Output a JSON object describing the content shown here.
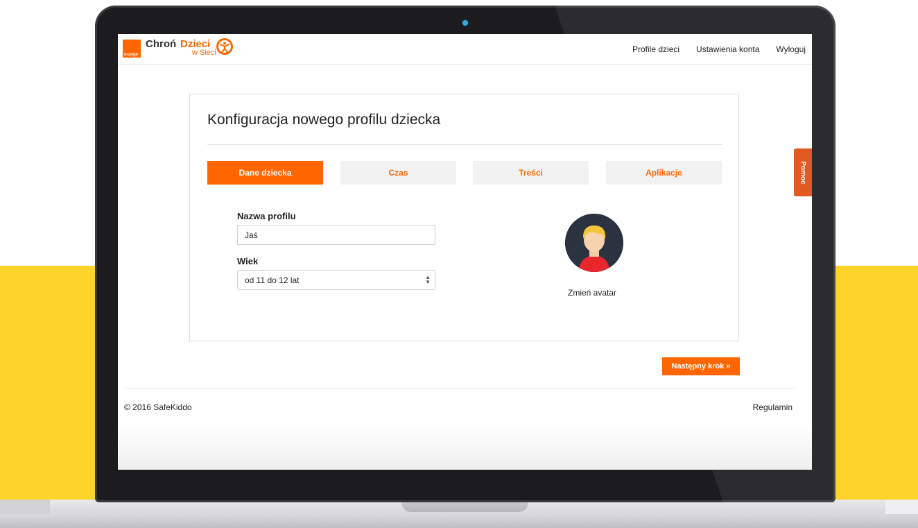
{
  "brand": {
    "orange_text": "orange",
    "chron": "Chroń",
    "dzieci": "Dzieci",
    "w_sieci": "w Sieci"
  },
  "nav": {
    "items": [
      "Profile dzieci",
      "Ustawienia konta",
      "Wyloguj"
    ]
  },
  "card": {
    "title": "Konfiguracja nowego profilu dziecka",
    "tabs": [
      "Dane dziecka",
      "Czas",
      "Treści",
      "Aplikacje"
    ],
    "active_tab": "Dane dziecka"
  },
  "form": {
    "name_label": "Nazwa profilu",
    "name_value": "Jaś",
    "age_label": "Wiek",
    "age_value": "od 11 do 12 lat"
  },
  "avatar": {
    "caption": "Zmień avatar"
  },
  "actions": {
    "next": "Następny krok »"
  },
  "footer": {
    "copyright": "© 2016 SafeKiddo",
    "terms": "Regulamin"
  },
  "help": {
    "label": "Pomoc"
  },
  "colors": {
    "accent": "#ff6600",
    "background_band": "#fcd42a",
    "help_tab": "#e05a22"
  }
}
